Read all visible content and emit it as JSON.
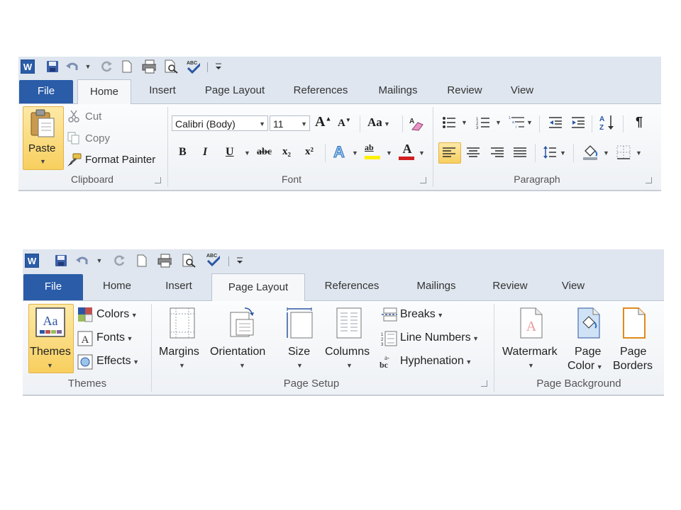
{
  "ribbon_home": {
    "tabs": [
      "File",
      "Home",
      "Insert",
      "Page Layout",
      "References",
      "Mailings",
      "Review",
      "View"
    ],
    "clipboard": {
      "paste": "Paste",
      "cut": "Cut",
      "copy": "Copy",
      "format_painter": "Format Painter",
      "group_label": "Clipboard"
    },
    "font": {
      "font_name": "Calibri (Body)",
      "font_size": "11",
      "change_case": "Aa",
      "bold": "B",
      "italic": "I",
      "underline": "U",
      "strike": "abc",
      "subscript": "x₂",
      "superscript": "x²",
      "highlight_glyph": "ab",
      "color_glyph": "A",
      "text_effects_glyph": "A",
      "grow_glyph": "A",
      "shrink_glyph": "A",
      "group_label": "Font"
    },
    "paragraph": {
      "group_label": "Paragraph",
      "pilcrow": "¶"
    }
  },
  "ribbon_layout": {
    "tabs": [
      "File",
      "Home",
      "Insert",
      "Page Layout",
      "References",
      "Mailings",
      "Review",
      "View"
    ],
    "themes": {
      "themes": "Themes",
      "colors": "Colors",
      "fonts": "Fonts",
      "effects": "Effects",
      "group_label": "Themes"
    },
    "page_setup": {
      "margins": "Margins",
      "orientation": "Orientation",
      "size": "Size",
      "columns": "Columns",
      "breaks": "Breaks",
      "line_numbers": "Line Numbers",
      "hyphenation": "Hyphenation",
      "group_label": "Page Setup"
    },
    "page_background": {
      "watermark": "Watermark",
      "page_color_1": "Page",
      "page_color_2": "Color",
      "page_borders_1": "Page",
      "page_borders_2": "Borders",
      "group_label": "Page Background"
    }
  },
  "colors": {
    "file_tab": "#2a5ca8",
    "highlight": "#f8cf5e",
    "font_color_red": "#d11f1f",
    "highlight_yellow": "#ffef00"
  }
}
